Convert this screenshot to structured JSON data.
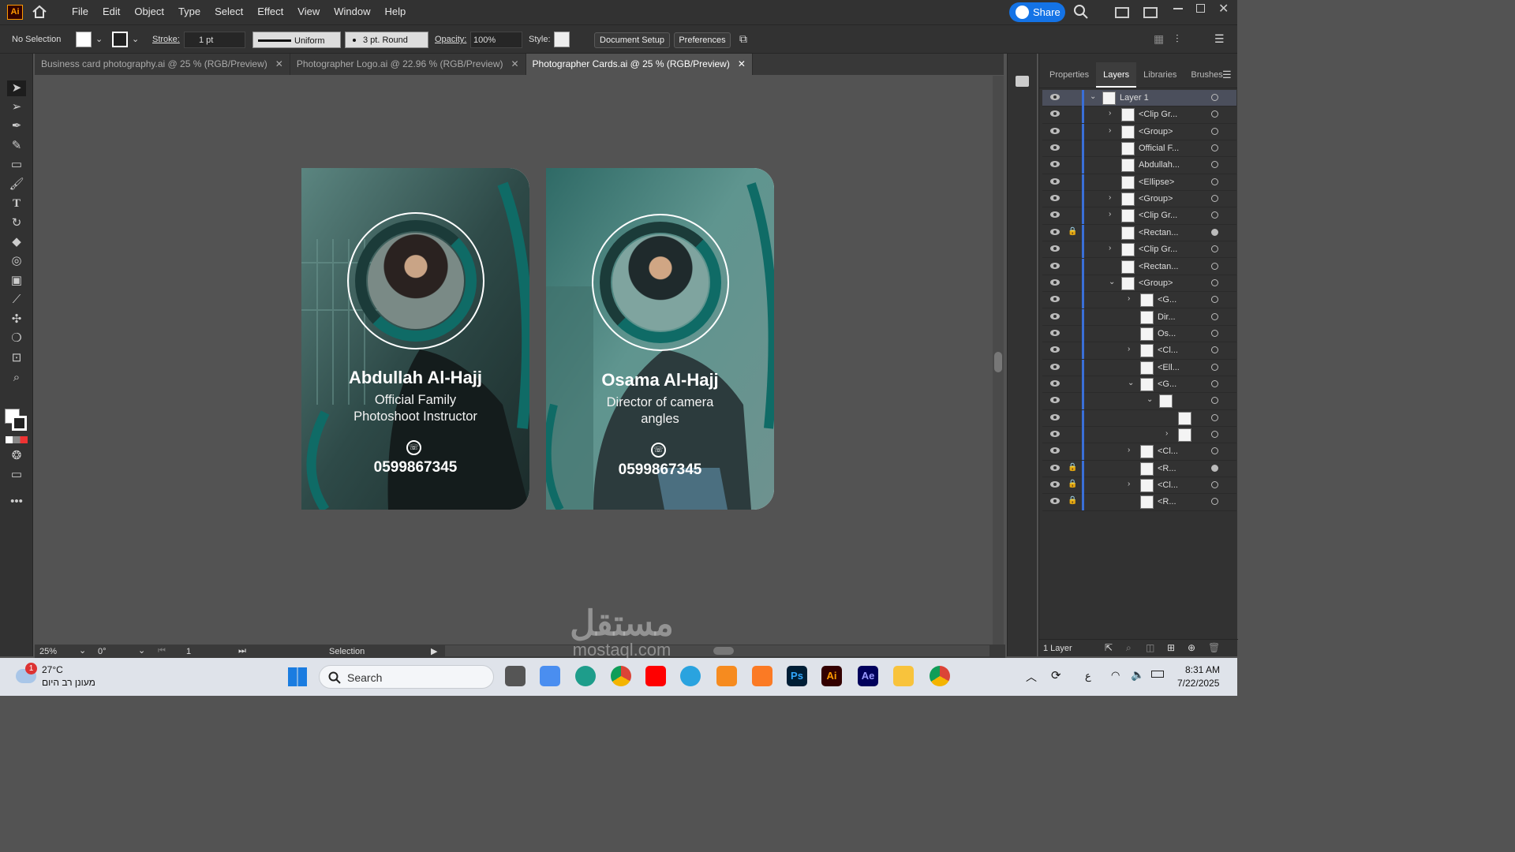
{
  "app": {
    "logo": "Ai",
    "share_label": "Share"
  },
  "menu": [
    "File",
    "Edit",
    "Object",
    "Type",
    "Select",
    "Effect",
    "View",
    "Window",
    "Help"
  ],
  "control": {
    "selection_state": "No Selection",
    "stroke_label": "Stroke:",
    "stroke_weight": "1 pt",
    "profile": "Uniform",
    "brush": "3 pt. Round",
    "opacity_label": "Opacity:",
    "opacity": "100%",
    "style_label": "Style:",
    "document_setup": "Document Setup",
    "preferences": "Preferences"
  },
  "tabs": [
    {
      "label": "Business card photography.ai @ 25 % (RGB/Preview)",
      "active": false
    },
    {
      "label": "Photographer  Logo.ai @ 22.96 % (RGB/Preview)",
      "active": false
    },
    {
      "label": "Photographer Cards.ai @ 25 % (RGB/Preview)",
      "active": true
    }
  ],
  "cards": [
    {
      "name": "Abdullah Al-Hajj",
      "role_line1": "Official Family",
      "role_line2": "Photoshoot Instructor",
      "phone": "0599867345"
    },
    {
      "name": "Osama Al-Hajj",
      "role_line1": "Director of camera",
      "role_line2": "angles",
      "phone": "0599867345"
    }
  ],
  "panel": {
    "tabs": [
      "Properties",
      "Layers",
      "Libraries",
      "Brushes"
    ],
    "active_tab": "Layers",
    "layers": [
      {
        "name": "Layer 1",
        "indent": 0,
        "twirl": "down",
        "lock": false,
        "filled": false,
        "sel": true
      },
      {
        "name": "<Clip Gr...",
        "indent": 1,
        "twirl": "right",
        "lock": false,
        "filled": false
      },
      {
        "name": "<Group>",
        "indent": 1,
        "twirl": "right",
        "lock": false,
        "filled": false
      },
      {
        "name": "Official F...",
        "indent": 1,
        "twirl": "",
        "lock": false,
        "filled": false
      },
      {
        "name": "Abdullah...",
        "indent": 1,
        "twirl": "",
        "lock": false,
        "filled": false
      },
      {
        "name": "<Ellipse>",
        "indent": 1,
        "twirl": "",
        "lock": false,
        "filled": false
      },
      {
        "name": "<Group>",
        "indent": 1,
        "twirl": "right",
        "lock": false,
        "filled": false
      },
      {
        "name": "<Clip Gr...",
        "indent": 1,
        "twirl": "right",
        "lock": false,
        "filled": false
      },
      {
        "name": "<Rectan...",
        "indent": 1,
        "twirl": "",
        "lock": true,
        "filled": true
      },
      {
        "name": "<Clip Gr...",
        "indent": 1,
        "twirl": "right",
        "lock": false,
        "filled": false
      },
      {
        "name": "<Rectan...",
        "indent": 1,
        "twirl": "",
        "lock": false,
        "filled": false
      },
      {
        "name": "<Group>",
        "indent": 1,
        "twirl": "down",
        "lock": false,
        "filled": false
      },
      {
        "name": "<G...",
        "indent": 2,
        "twirl": "right",
        "lock": false,
        "filled": false
      },
      {
        "name": "Dir...",
        "indent": 2,
        "twirl": "",
        "lock": false,
        "filled": false
      },
      {
        "name": "Os...",
        "indent": 2,
        "twirl": "",
        "lock": false,
        "filled": false
      },
      {
        "name": "<Cl...",
        "indent": 2,
        "twirl": "right",
        "lock": false,
        "filled": false
      },
      {
        "name": "<Ell...",
        "indent": 2,
        "twirl": "",
        "lock": false,
        "filled": false
      },
      {
        "name": "<G...",
        "indent": 2,
        "twirl": "down",
        "lock": false,
        "filled": false
      },
      {
        "name": "",
        "indent": 3,
        "twirl": "down",
        "lock": false,
        "filled": false
      },
      {
        "name": "",
        "indent": 4,
        "twirl": "",
        "lock": false,
        "filled": false
      },
      {
        "name": "",
        "indent": 4,
        "twirl": "right",
        "lock": false,
        "filled": false
      },
      {
        "name": "<Cl...",
        "indent": 2,
        "twirl": "right",
        "lock": false,
        "filled": false
      },
      {
        "name": "<R...",
        "indent": 2,
        "twirl": "",
        "lock": true,
        "filled": true
      },
      {
        "name": "<Cl...",
        "indent": 2,
        "twirl": "right",
        "lock": true,
        "filled": false
      },
      {
        "name": "<R...",
        "indent": 2,
        "twirl": "",
        "lock": true,
        "filled": false
      }
    ],
    "footer": "1 Layer"
  },
  "status": {
    "zoom": "25%",
    "rotation": "0°",
    "artboard": "1",
    "tool": "Selection"
  },
  "watermark": {
    "arabic": "مستقل",
    "latin": "mostaql.com"
  },
  "taskbar": {
    "weather_temp": "27°C",
    "weather_desc": "מעונן רב היום",
    "weather_badge": "1",
    "search_placeholder": "Search",
    "time": "8:31 AM",
    "date": "7/22/2025",
    "lang": "ع"
  },
  "colors": {
    "teal": "#0f6b66",
    "accent_blue": "#1473e6"
  }
}
